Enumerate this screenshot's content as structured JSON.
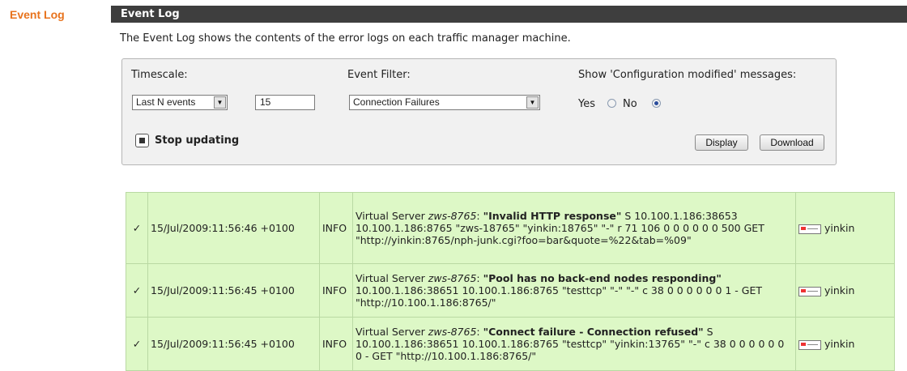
{
  "sidebar": {
    "title": "Event Log"
  },
  "header": {
    "title": "Event Log"
  },
  "description": "The Event Log shows the contents of the error logs on each traffic manager machine.",
  "controls": {
    "timescale_label": "Timescale:",
    "timescale_value": "Last N events",
    "count_value": "15",
    "filter_label": "Event Filter:",
    "filter_value": "Connection Failures",
    "config_label": "Show 'Configuration modified' messages:",
    "yes_label": "Yes",
    "no_label": "No",
    "selected_option": "No",
    "stop_label": "Stop updating",
    "display_label": "Display",
    "download_label": "Download"
  },
  "log_rows": [
    {
      "status_icon": "check-icon",
      "timestamp": "15/Jul/2009:11:56:46 +0100",
      "level": "INFO",
      "prefix": "Virtual Server ",
      "server": "zws-8765",
      "sep": ": ",
      "title": "\"Invalid HTTP response\"",
      "detail": " S 10.100.1.186:38653 10.100.1.186:8765 \"zws-18765\" \"yinkin:18765\" \"-\" r 71 106 0 0 0 0 0 0 500 GET \"http://yinkin:8765/nph-junk.cgi?foo=bar&quote=%22&tab=%09\"",
      "host": "yinkin"
    },
    {
      "status_icon": "check-icon",
      "timestamp": "15/Jul/2009:11:56:45 +0100",
      "level": "INFO",
      "prefix": "Virtual Server ",
      "server": "zws-8765",
      "sep": ": ",
      "title": "\"Pool has no back-end nodes responding\"",
      "detail": " 10.100.1.186:38651 10.100.1.186:8765 \"testtcp\" \"-\" \"-\" c 38 0 0 0 0 0 0 1 - GET \"http://10.100.1.186:8765/\"",
      "host": "yinkin"
    },
    {
      "status_icon": "check-icon",
      "timestamp": "15/Jul/2009:11:56:45 +0100",
      "level": "INFO",
      "prefix": "Virtual Server ",
      "server": "zws-8765",
      "sep": ": ",
      "title": "\"Connect failure - Connection refused\"",
      "detail": " S 10.100.1.186:38651 10.100.1.186:8765 \"testtcp\" \"yinkin:13765\" \"-\" c 38 0 0 0 0 0 0 0 - GET \"http://10.100.1.186:8765/\"",
      "host": "yinkin"
    }
  ],
  "colors": {
    "accent": "#e8731d",
    "header_bg": "#3e3e3e",
    "row_bg": "#ddf8c6",
    "check": "#3ca32c"
  }
}
